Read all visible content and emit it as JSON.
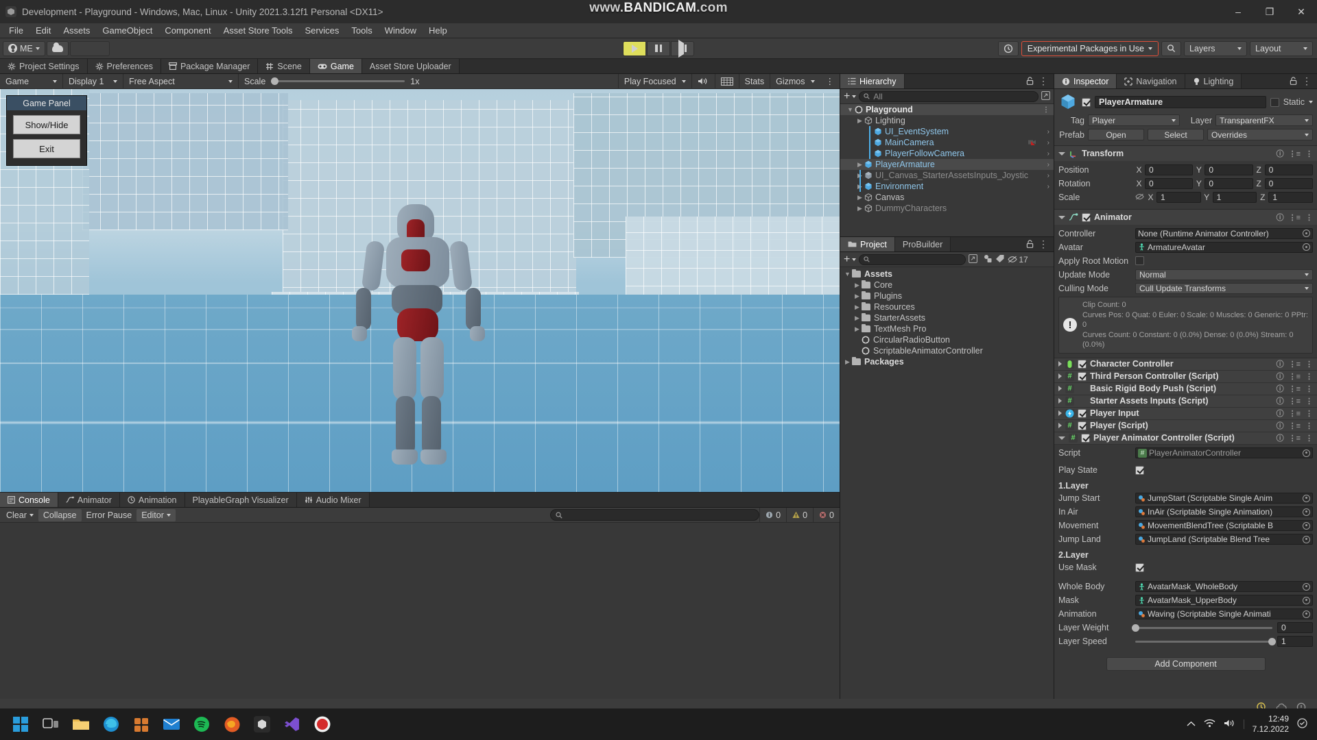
{
  "titlebar": {
    "title": "Development - Playground - Windows, Mac, Linux - Unity 2021.3.12f1 Personal <DX11>",
    "watermark_prefix": "www.",
    "watermark_main": "BANDICAM",
    "watermark_suffix": ".com",
    "minimize": "–",
    "maximize": "❐",
    "close": "✕"
  },
  "menubar": {
    "items": [
      "File",
      "Edit",
      "Assets",
      "GameObject",
      "Component",
      "Asset Store Tools",
      "Services",
      "Tools",
      "Window",
      "Help"
    ]
  },
  "toolbar": {
    "account_label": "ME",
    "cloud_icon": "cloud-icon",
    "play_icon": "play-icon",
    "pause_icon": "pause-icon",
    "step_icon": "step-icon",
    "history_icon": "history-icon",
    "experimental_badge": "Experimental Packages in Use",
    "search_icon": "search-icon",
    "layers_label": "Layers",
    "layout_label": "Layout"
  },
  "dock_tabs": [
    {
      "label": "Project Settings",
      "icon": "gear-icon",
      "active": false
    },
    {
      "label": "Preferences",
      "icon": "gear-icon",
      "active": false
    },
    {
      "label": "Package Manager",
      "icon": "package-icon",
      "active": false
    },
    {
      "label": "Scene",
      "icon": "scene-icon",
      "active": false
    },
    {
      "label": "Game",
      "icon": "gamepad-icon",
      "active": true
    },
    {
      "label": "Asset Store Uploader",
      "icon": "",
      "active": false
    }
  ],
  "gameview": {
    "mode": "Game",
    "display": "Display 1",
    "aspect": "Free Aspect",
    "scale_label": "Scale",
    "scale_value": "1x",
    "play_focused": "Play Focused",
    "mute_icon": "speaker-icon",
    "grid_icon": "grid-icon",
    "stats_label": "Stats",
    "gizmos_label": "Gizmos",
    "panel": {
      "title": "Game Panel",
      "buttons": [
        "Show/Hide",
        "Exit"
      ]
    }
  },
  "hierarchy": {
    "tab_label": "Hierarchy",
    "tab_icon": "hierarchy-icon",
    "add_label": "+",
    "search_placeholder": "All",
    "items": [
      {
        "label": "Playground",
        "depth": 0,
        "icon": "unity-icon",
        "arrow": "▼",
        "selected": true,
        "bar": false,
        "chevron": false,
        "dim": false
      },
      {
        "label": "Lighting",
        "depth": 1,
        "icon": "prefab-grey-icon",
        "arrow": "▶",
        "selected": false,
        "bar": false,
        "chevron": false,
        "dim": false
      },
      {
        "label": "UI_EventSystem",
        "depth": 2,
        "icon": "prefab-blue-icon",
        "arrow": "",
        "selected": false,
        "bar": true,
        "chevron": true,
        "dim": false
      },
      {
        "label": "MainCamera",
        "depth": 2,
        "icon": "prefab-blue-icon",
        "arrow": "",
        "selected": false,
        "bar": true,
        "chevron": true,
        "dim": false
      },
      {
        "label": "PlayerFollowCamera",
        "depth": 2,
        "icon": "prefab-blue-icon",
        "arrow": "",
        "selected": false,
        "bar": true,
        "chevron": true,
        "dim": false
      },
      {
        "label": "PlayerArmature",
        "depth": 1,
        "icon": "prefab-blue-icon",
        "arrow": "▶",
        "selected": true,
        "bar": false,
        "chevron": true,
        "dim": false
      },
      {
        "label": "UI_Canvas_StarterAssetsInputs_Joystic",
        "depth": 1,
        "icon": "prefab-grey2-icon",
        "arrow": "▶",
        "selected": false,
        "bar": true,
        "chevron": true,
        "dim": true
      },
      {
        "label": "Environment",
        "depth": 1,
        "icon": "prefab-blue-icon",
        "arrow": "▶",
        "selected": false,
        "bar": true,
        "chevron": true,
        "dim": false
      },
      {
        "label": "Canvas",
        "depth": 1,
        "icon": "prefab-grey-icon",
        "arrow": "▶",
        "selected": false,
        "bar": false,
        "chevron": false,
        "dim": false
      },
      {
        "label": "DummyCharacters",
        "depth": 1,
        "icon": "prefab-grey-icon",
        "arrow": "▶",
        "selected": false,
        "bar": false,
        "chevron": false,
        "dim": true
      }
    ]
  },
  "project": {
    "tabs": [
      {
        "label": "Project",
        "icon": "folder-icon",
        "active": true
      },
      {
        "label": "ProBuilder",
        "icon": "",
        "active": false
      }
    ],
    "search_placeholder": "",
    "badge_count": "17",
    "items": [
      {
        "label": "Assets",
        "depth": 0,
        "type": "folder",
        "arrow": "▼",
        "bold": true
      },
      {
        "label": "Core",
        "depth": 1,
        "type": "folder",
        "arrow": "▶",
        "bold": false
      },
      {
        "label": "Plugins",
        "depth": 1,
        "type": "folder",
        "arrow": "▶",
        "bold": false
      },
      {
        "label": "Resources",
        "depth": 1,
        "type": "folder",
        "arrow": "▶",
        "bold": false
      },
      {
        "label": "StarterAssets",
        "depth": 1,
        "type": "folder",
        "arrow": "▶",
        "bold": false
      },
      {
        "label": "TextMesh Pro",
        "depth": 1,
        "type": "folder",
        "arrow": "▶",
        "bold": false
      },
      {
        "label": "CircularRadioButton",
        "depth": 1,
        "type": "unity",
        "arrow": "",
        "bold": false
      },
      {
        "label": "ScriptableAnimatorController",
        "depth": 1,
        "type": "unity",
        "arrow": "",
        "bold": false
      },
      {
        "label": "Packages",
        "depth": 0,
        "type": "folder",
        "arrow": "▶",
        "bold": true
      }
    ]
  },
  "console": {
    "tabs": [
      {
        "label": "Console",
        "icon": "console-icon",
        "active": true
      },
      {
        "label": "Animator",
        "icon": "animator-icon",
        "active": false
      },
      {
        "label": "Animation",
        "icon": "animation-icon",
        "active": false
      },
      {
        "label": "PlayableGraph Visualizer",
        "icon": "",
        "active": false
      },
      {
        "label": "Audio Mixer",
        "icon": "mixer-icon",
        "active": false
      }
    ],
    "clear_label": "Clear",
    "collapse_label": "Collapse",
    "errorpause_label": "Error Pause",
    "editor_label": "Editor",
    "search_placeholder": "",
    "counts": {
      "log": "0",
      "warning": "0",
      "error": "0"
    }
  },
  "inspector": {
    "tabs": [
      {
        "label": "Inspector",
        "icon": "info-icon",
        "active": true
      },
      {
        "label": "Navigation",
        "icon": "navigation-icon",
        "active": false
      },
      {
        "label": "Lighting",
        "icon": "bulb-icon",
        "active": false
      }
    ],
    "object_name": "PlayerArmature",
    "object_enabled": true,
    "static_label": "Static",
    "tag_label": "Tag",
    "tag_value": "Player",
    "layer_label": "Layer",
    "layer_value": "TransparentFX",
    "prefab_label": "Prefab",
    "prefab_open": "Open",
    "prefab_select": "Select",
    "prefab_overrides": "Overrides",
    "transform": {
      "title": "Transform",
      "rows": [
        {
          "label": "Position",
          "x": "0",
          "y": "0",
          "z": "0",
          "link": false
        },
        {
          "label": "Rotation",
          "x": "0",
          "y": "0",
          "z": "0",
          "link": false
        },
        {
          "label": "Scale",
          "x": "1",
          "y": "1",
          "z": "1",
          "link": true
        }
      ]
    },
    "animator": {
      "title": "Animator",
      "enabled": true,
      "controller_label": "Controller",
      "controller_value": "None (Runtime Animator Controller)",
      "avatar_label": "Avatar",
      "avatar_value": "ArmatureAvatar",
      "rootmotion_label": "Apply Root Motion",
      "rootmotion_checked": false,
      "updatemode_label": "Update Mode",
      "updatemode_value": "Normal",
      "cullingmode_label": "Culling Mode",
      "cullingmode_value": "Cull Update Transforms",
      "info_lines": [
        "Clip Count: 0",
        "Curves Pos: 0 Quat: 0 Euler: 0 Scale: 0 Muscles: 0 Generic: 0 PPtr: 0",
        "Curves Count: 0 Constant: 0 (0.0%) Dense: 0 (0.0%) Stream: 0 (0.0%)"
      ]
    },
    "components": [
      {
        "label": "Character Controller",
        "icon": "capsule-icon",
        "checkbox": true,
        "checked": true,
        "expanded": false
      },
      {
        "label": "Third Person Controller (Script)",
        "icon": "script-icon",
        "checkbox": true,
        "checked": true,
        "expanded": false
      },
      {
        "label": "Basic Rigid Body Push (Script)",
        "icon": "script-icon",
        "checkbox": false,
        "checked": false,
        "expanded": false
      },
      {
        "label": "Starter Assets Inputs (Script)",
        "icon": "script-icon",
        "checkbox": false,
        "checked": false,
        "expanded": false
      },
      {
        "label": "Player Input",
        "icon": "playerinput-icon",
        "checkbox": true,
        "checked": true,
        "expanded": false
      },
      {
        "label": "Player (Script)",
        "icon": "script-icon",
        "checkbox": true,
        "checked": true,
        "expanded": false
      },
      {
        "label": "Player Animator Controller (Script)",
        "icon": "script-icon",
        "checkbox": true,
        "checked": true,
        "expanded": true
      }
    ],
    "pac": {
      "script_label": "Script",
      "script_value": "PlayerAnimatorController",
      "playstate_label": "Play State",
      "playstate_checked": true,
      "layer1_title": "1.Layer",
      "layer1_rows": [
        {
          "label": "Jump Start",
          "value": "JumpStart (Scriptable Single Anim"
        },
        {
          "label": "In Air",
          "value": "InAir (Scriptable Single Animation)"
        },
        {
          "label": "Movement",
          "value": "MovementBlendTree (Scriptable B"
        },
        {
          "label": "Jump Land",
          "value": "JumpLand (Scriptable Blend Tree"
        }
      ],
      "layer2_title": "2.Layer",
      "usemask_label": "Use Mask",
      "usemask_checked": true,
      "layer2_rows": [
        {
          "label": "Whole Body",
          "value": "AvatarMask_WholeBody",
          "icon": "avatar-icon"
        },
        {
          "label": "Mask",
          "value": "AvatarMask_UpperBody",
          "icon": "avatar-icon"
        },
        {
          "label": "Animation",
          "value": "Waving (Scriptable Single Animati",
          "icon": "scriptable-icon"
        }
      ],
      "layerweight_label": "Layer Weight",
      "layerweight_value": "0",
      "layerweight_pct": 0,
      "layerspeed_label": "Layer Speed",
      "layerspeed_value": "1",
      "layerspeed_pct": 100,
      "add_component": "Add Component"
    }
  },
  "taskbar": {
    "apps": [
      {
        "name": "start-windows-icon"
      },
      {
        "name": "task-view-icon"
      },
      {
        "name": "file-explorer-icon"
      },
      {
        "name": "edge-browser-icon"
      },
      {
        "name": "store-icon"
      },
      {
        "name": "mail-icon"
      },
      {
        "name": "spotify-icon"
      },
      {
        "name": "firefox-icon"
      },
      {
        "name": "unity-hub-icon"
      },
      {
        "name": "visual-studio-icon"
      },
      {
        "name": "bandicam-recorder-icon"
      }
    ],
    "time": "12:49",
    "date": "7.12.2022",
    "tray_icons": [
      "chevron-up-icon",
      "network-icon",
      "volume-icon"
    ]
  },
  "colors": {
    "accent_orange": "#e04e39",
    "play_active": "#dede5c",
    "selection_blue": "#4eb0e8",
    "panel_bg": "#383838",
    "toolbar_bg": "#3c3c3c"
  }
}
